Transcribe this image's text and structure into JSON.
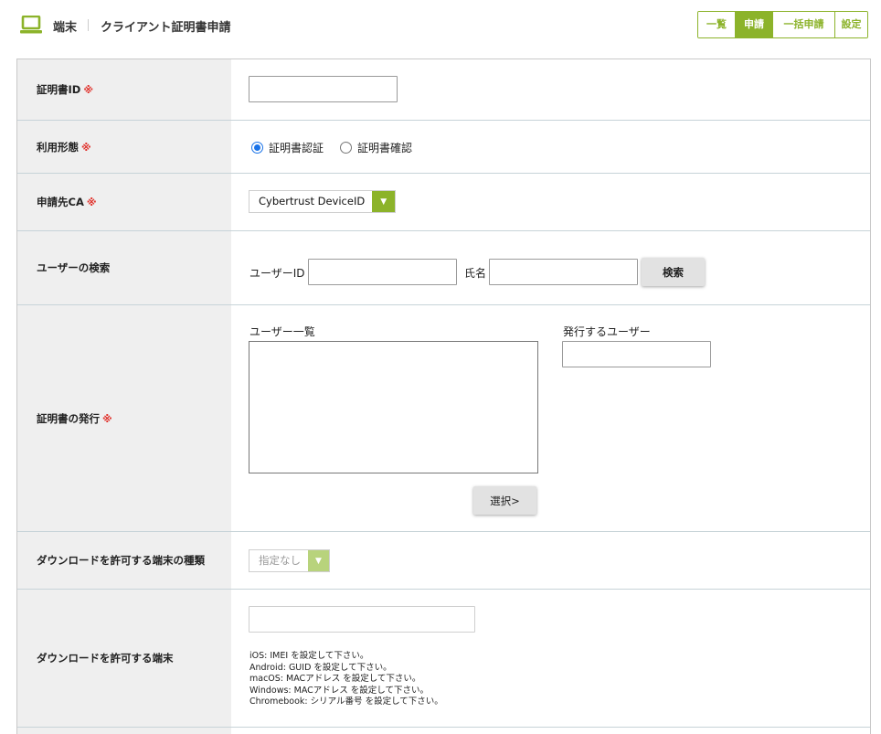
{
  "header": {
    "section": "端末",
    "title": "クライアント証明書申請",
    "icon": "laptop-icon",
    "accent_color": "#8cb32a"
  },
  "tabs": [
    {
      "label": "一覧",
      "active": false
    },
    {
      "label": "申請",
      "active": true
    },
    {
      "label": "一括申請",
      "active": false
    },
    {
      "label": "設定",
      "active": false
    }
  ],
  "required_mark": "※",
  "form": {
    "cert_id": {
      "label": "証明書ID",
      "value": ""
    },
    "usage": {
      "label": "利用形態",
      "options": [
        {
          "label": "証明書認証",
          "checked": true
        },
        {
          "label": "証明書確認",
          "checked": false
        }
      ]
    },
    "ca": {
      "label": "申請先CA",
      "selected": "Cybertrust DeviceID"
    },
    "user_search": {
      "label": "ユーザーの検索",
      "user_id_label": "ユーザーID",
      "user_id_value": "",
      "name_label": "氏名",
      "name_value": "",
      "search_button": "検索"
    },
    "issue": {
      "label": "証明書の発行",
      "user_list_label": "ユーザー一覧",
      "issuing_user_label": "発行するユーザー",
      "issuing_user_value": "",
      "select_button": "選択>"
    },
    "device_type": {
      "label": "ダウンロードを許可する端末の種類",
      "selected": "指定なし"
    },
    "device": {
      "label": "ダウンロードを許可する端末",
      "value": "",
      "hints": [
        "iOS: IMEI を設定して下さい。",
        "Android: GUID を設定して下さい。",
        "macOS: MACアドレス を設定して下さい。",
        "Windows: MACアドレス を設定して下さい。",
        "Chromebook: シリアル番号 を設定して下さい。"
      ]
    }
  }
}
